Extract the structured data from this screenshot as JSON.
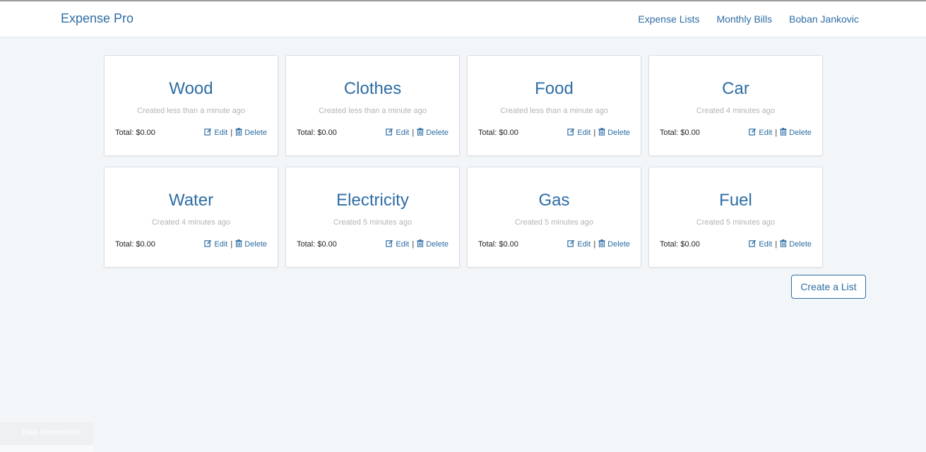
{
  "navbar": {
    "brand": "Expense Pro",
    "links": [
      "Expense Lists",
      "Monthly Bills",
      "Boban Jankovic"
    ]
  },
  "lists": [
    {
      "title": "Wood",
      "created": "Created less than a minute ago",
      "total": "Total: $0.00",
      "edit": "Edit",
      "delete": "Delete"
    },
    {
      "title": "Clothes",
      "created": "Created less than a minute ago",
      "total": "Total: $0.00",
      "edit": "Edit",
      "delete": "Delete"
    },
    {
      "title": "Food",
      "created": "Created less than a minute ago",
      "total": "Total: $0.00",
      "edit": "Edit",
      "delete": "Delete"
    },
    {
      "title": "Car",
      "created": "Created 4 minutes ago",
      "total": "Total: $0.00",
      "edit": "Edit",
      "delete": "Delete"
    },
    {
      "title": "Water",
      "created": "Created 4 minutes ago",
      "total": "Total: $0.00",
      "edit": "Edit",
      "delete": "Delete"
    },
    {
      "title": "Electricity",
      "created": "Created 5 minutes ago",
      "total": "Total: $0.00",
      "edit": "Edit",
      "delete": "Delete"
    },
    {
      "title": "Gas",
      "created": "Created 5 minutes ago",
      "total": "Total: $0.00",
      "edit": "Edit",
      "delete": "Delete"
    },
    {
      "title": "Fuel",
      "created": "Created 5 minutes ago",
      "total": "Total: $0.00",
      "edit": "Edit",
      "delete": "Delete"
    }
  ],
  "create_button": "Create a List",
  "screenshot_widget": {
    "label": "Take Screenshot"
  },
  "icons": {
    "edit": "edit-icon",
    "delete": "trash-icon"
  },
  "colors": {
    "accent": "#2e6da4",
    "background": "#f3f6f9"
  }
}
